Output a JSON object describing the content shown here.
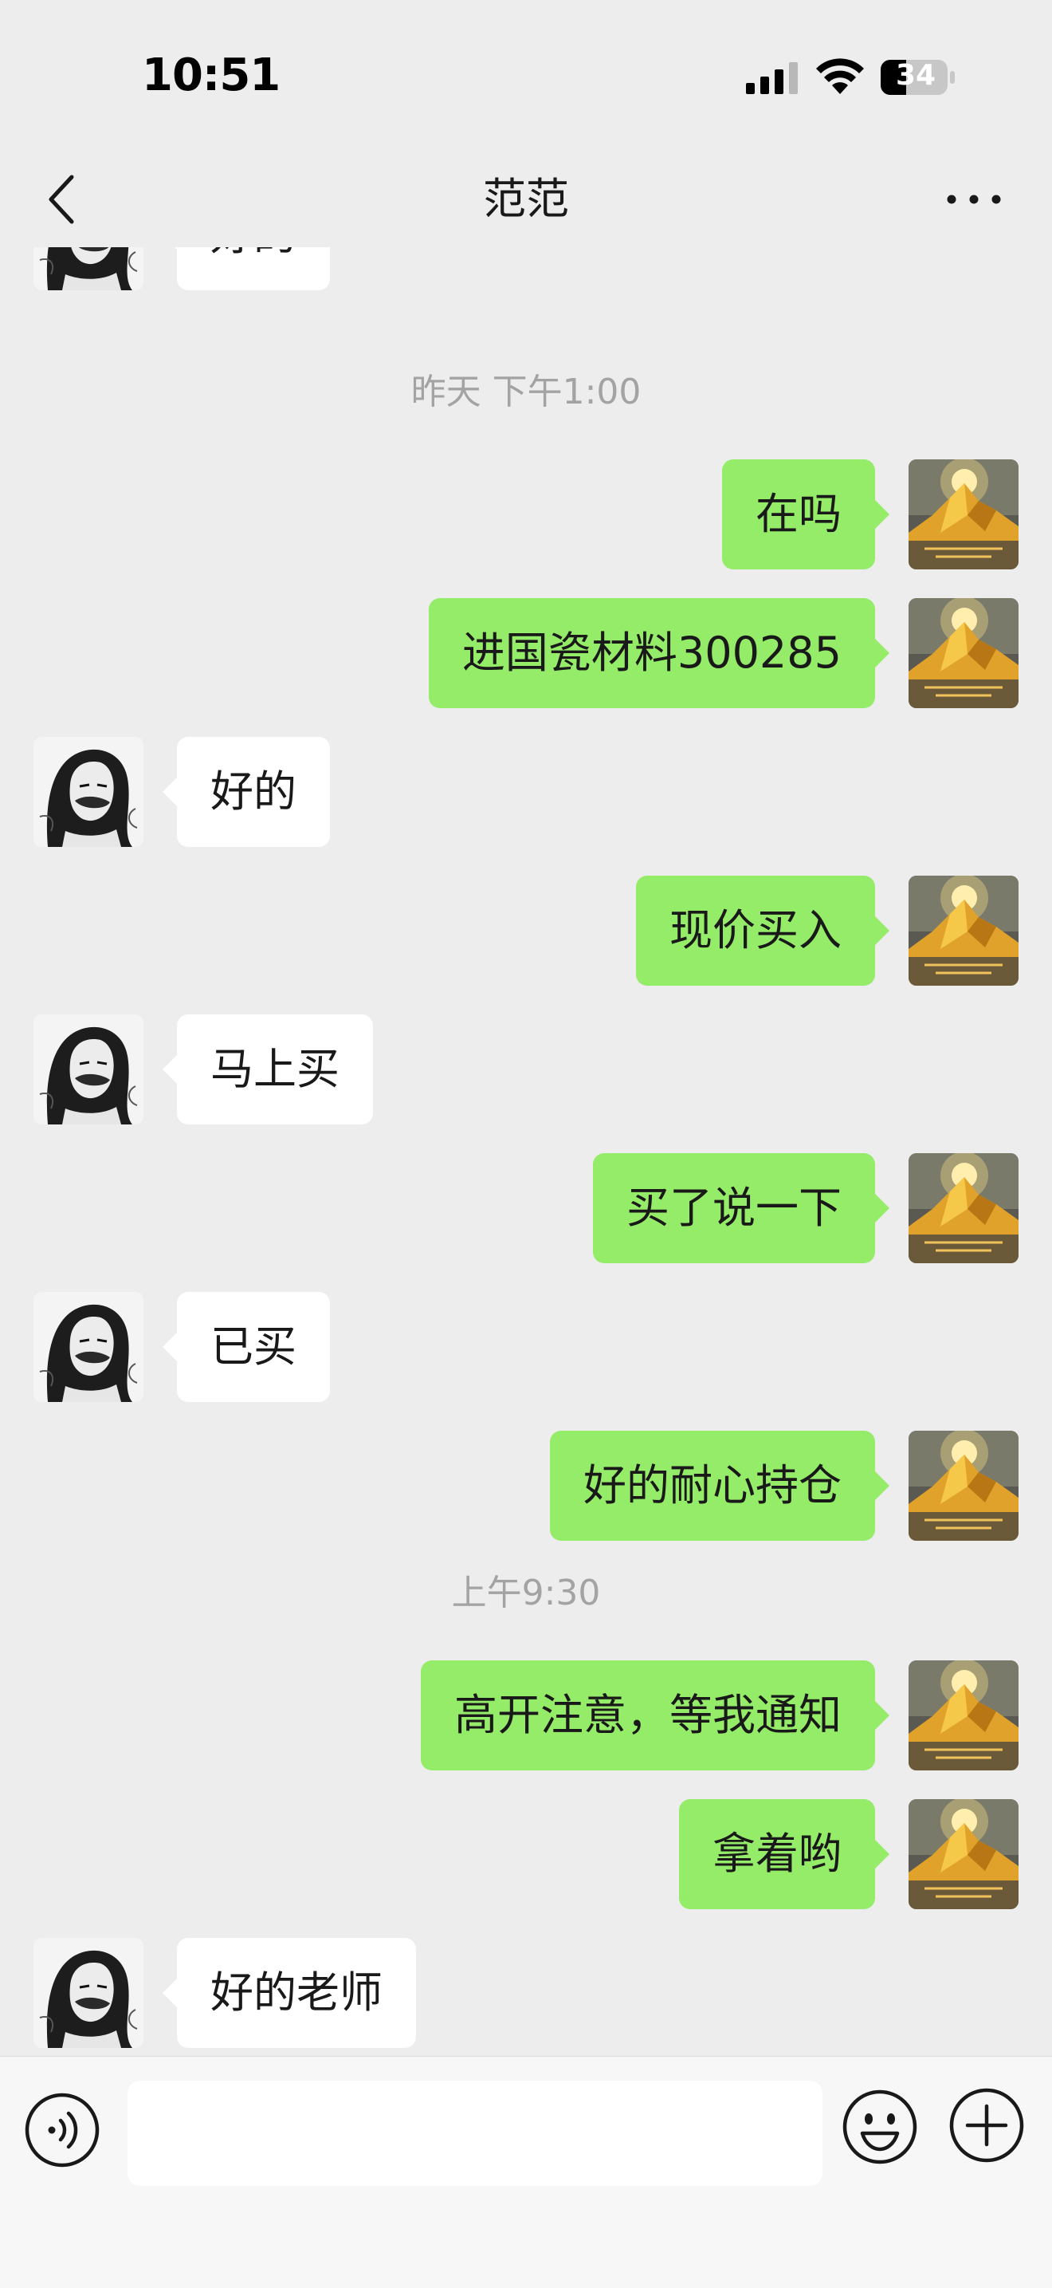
{
  "status_bar": {
    "time": "10:51",
    "battery": "34"
  },
  "nav": {
    "title": "范范"
  },
  "colors": {
    "background": "#ededed",
    "outgoing_bubble": "#95ec69",
    "incoming_bubble": "#ffffff",
    "timestamp_text": "#a3a3a3"
  },
  "messages": [
    {
      "side": "in",
      "text": "好的"
    },
    {
      "side": "time",
      "text": "昨天 下午1:00"
    },
    {
      "side": "out",
      "text": "在吗"
    },
    {
      "side": "out",
      "text": "进国瓷材料300285"
    },
    {
      "side": "in",
      "text": "好的"
    },
    {
      "side": "out",
      "text": "现价买入"
    },
    {
      "side": "in",
      "text": "马上买"
    },
    {
      "side": "out",
      "text": "买了说一下"
    },
    {
      "side": "in",
      "text": "已买"
    },
    {
      "side": "out",
      "text": "好的耐心持仓"
    },
    {
      "side": "time",
      "text": "上午9:30"
    },
    {
      "side": "out",
      "text": "高开注意，等我通知"
    },
    {
      "side": "out",
      "text": "拿着哟"
    },
    {
      "side": "in",
      "text": "好的老师"
    }
  ],
  "input_bar": {
    "input_value": "",
    "icons": [
      "voice-icon",
      "emoji-icon",
      "plus-icon"
    ]
  }
}
